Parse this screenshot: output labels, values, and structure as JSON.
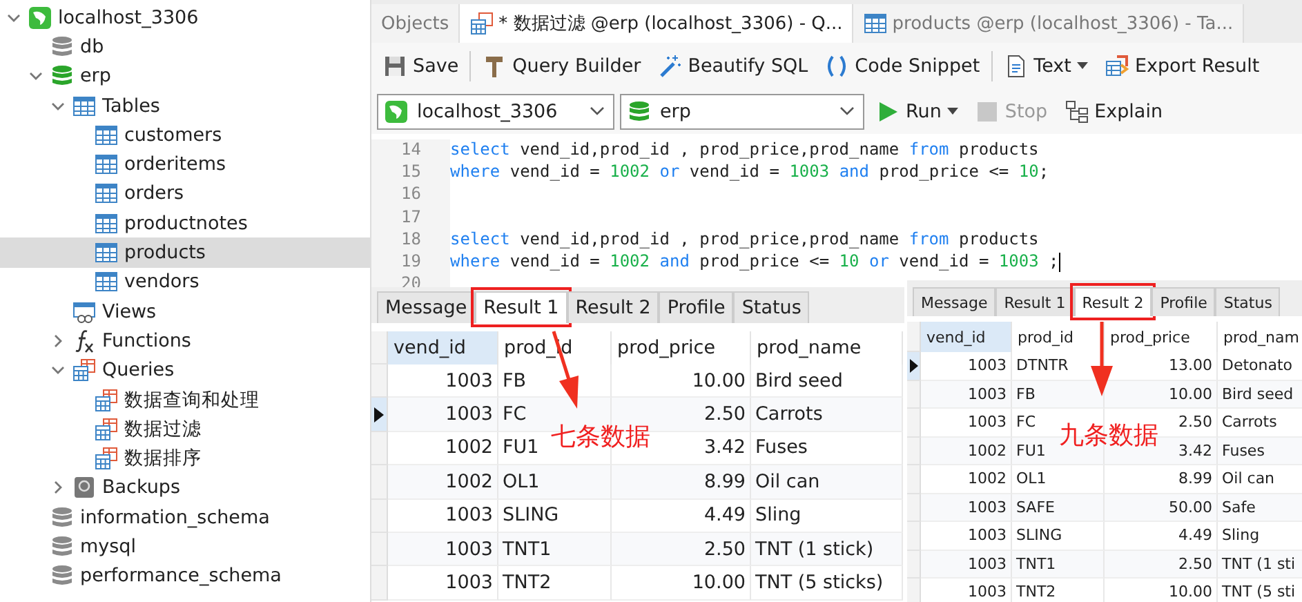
{
  "sidebar": {
    "items": [
      {
        "label": "localhost_3306",
        "kind": "connection",
        "expanded": true,
        "selected": false,
        "children": [
          {
            "label": "db",
            "kind": "database",
            "selected": false
          },
          {
            "label": "erp",
            "kind": "database-open",
            "expanded": true,
            "selected": false,
            "children": [
              {
                "label": "Tables",
                "kind": "tables",
                "expanded": true,
                "selected": false,
                "children": [
                  {
                    "label": "customers",
                    "kind": "table",
                    "selected": false
                  },
                  {
                    "label": "orderitems",
                    "kind": "table",
                    "selected": false
                  },
                  {
                    "label": "orders",
                    "kind": "table",
                    "selected": false
                  },
                  {
                    "label": "productnotes",
                    "kind": "table",
                    "selected": false
                  },
                  {
                    "label": "products",
                    "kind": "table",
                    "selected": true
                  },
                  {
                    "label": "vendors",
                    "kind": "table",
                    "selected": false
                  }
                ]
              },
              {
                "label": "Views",
                "kind": "views",
                "selected": false
              },
              {
                "label": "Functions",
                "kind": "functions",
                "expanded": false,
                "selected": false
              },
              {
                "label": "Queries",
                "kind": "queries",
                "expanded": true,
                "selected": false,
                "children": [
                  {
                    "label": "数据查询和处理",
                    "kind": "query",
                    "selected": false
                  },
                  {
                    "label": "数据过滤",
                    "kind": "query",
                    "selected": false
                  },
                  {
                    "label": "数据排序",
                    "kind": "query",
                    "selected": false
                  }
                ]
              },
              {
                "label": "Backups",
                "kind": "backups",
                "expanded": false,
                "selected": false
              }
            ]
          },
          {
            "label": "information_schema",
            "kind": "database",
            "selected": false
          },
          {
            "label": "mysql",
            "kind": "database",
            "selected": false
          },
          {
            "label": "performance_schema",
            "kind": "database",
            "selected": false
          }
        ]
      }
    ]
  },
  "tabs": [
    {
      "label": "Objects",
      "kind": "plain",
      "selected": false
    },
    {
      "label": "* 数据过滤 @erp (localhost_3306) - Q...",
      "kind": "query",
      "selected": true
    },
    {
      "label": "products @erp (localhost_3306) - Ta...",
      "kind": "table",
      "selected": false
    }
  ],
  "toolbar": [
    {
      "label": "Save",
      "kind": "save"
    },
    {
      "label": "Query Builder",
      "kind": "builder"
    },
    {
      "label": "Beautify SQL",
      "kind": "beautify"
    },
    {
      "label": "Code Snippet",
      "kind": "snippet"
    },
    {
      "label": "Text",
      "kind": "text"
    },
    {
      "label": "Export Result",
      "kind": "export"
    }
  ],
  "selectors": {
    "connection": "localhost_3306",
    "database": "erp"
  },
  "actions": [
    {
      "label": "Run",
      "kind": "run",
      "disabled": false
    },
    {
      "label": "Stop",
      "kind": "stop",
      "disabled": true
    },
    {
      "label": "Explain",
      "kind": "explain",
      "disabled": false
    }
  ],
  "editor": {
    "lines": [
      {
        "number": "14",
        "tokens": [
          {
            "text": "select",
            "kind": "keyword"
          },
          {
            "text": " vend_id,prod_id , prod_price,prod_name ",
            "kind": "plain"
          },
          {
            "text": "from",
            "kind": "keyword"
          },
          {
            "text": " products",
            "kind": "plain"
          }
        ]
      },
      {
        "number": "15",
        "tokens": [
          {
            "text": "where",
            "kind": "keyword"
          },
          {
            "text": " vend_id = ",
            "kind": "plain"
          },
          {
            "text": "1002",
            "kind": "number"
          },
          {
            "text": " or",
            "kind": "keyword"
          },
          {
            "text": " vend_id = ",
            "kind": "plain"
          },
          {
            "text": "1003",
            "kind": "number"
          },
          {
            "text": " and",
            "kind": "keyword"
          },
          {
            "text": " prod_price <= ",
            "kind": "plain"
          },
          {
            "text": "10",
            "kind": "number"
          },
          {
            "text": ";",
            "kind": "plain"
          }
        ]
      },
      {
        "number": "16"
      },
      {
        "number": "17"
      },
      {
        "number": "18",
        "tokens": [
          {
            "text": "select",
            "kind": "keyword"
          },
          {
            "text": " vend_id,prod_id , prod_price,prod_name ",
            "kind": "plain"
          },
          {
            "text": "from",
            "kind": "keyword"
          },
          {
            "text": " products",
            "kind": "plain"
          }
        ]
      },
      {
        "number": "19",
        "tokens": [
          {
            "text": "where",
            "kind": "keyword"
          },
          {
            "text": " vend_id = ",
            "kind": "plain"
          },
          {
            "text": "1002",
            "kind": "number"
          },
          {
            "text": " and",
            "kind": "keyword"
          },
          {
            "text": " prod_price <= ",
            "kind": "plain"
          },
          {
            "text": "10",
            "kind": "number"
          },
          {
            "text": " or",
            "kind": "keyword"
          },
          {
            "text": " vend_id = ",
            "kind": "plain"
          },
          {
            "text": "1003",
            "kind": "number"
          },
          {
            "text": " ;",
            "kind": "plain"
          }
        ]
      },
      {
        "number": "20"
      }
    ]
  },
  "results": [
    {
      "tabs": [
        {
          "label": "Message",
          "selected": false
        },
        {
          "label": "Result 1",
          "selected": true
        },
        {
          "label": "Result 2",
          "selected": false
        },
        {
          "label": "Profile",
          "selected": false
        },
        {
          "label": "Status",
          "selected": false
        }
      ],
      "columns": [
        {
          "label": "vend_id",
          "kind": "number"
        },
        {
          "label": "prod_id",
          "kind": "text"
        },
        {
          "label": "prod_price",
          "kind": "number"
        },
        {
          "label": "prod_name",
          "kind": "text"
        }
      ],
      "rows": [
        {
          "cells": [
            "1003",
            "FB",
            "10.00",
            "Bird seed"
          ],
          "selected": false
        },
        {
          "cells": [
            "1003",
            "FC",
            "2.50",
            "Carrots"
          ],
          "selected": true
        },
        {
          "cells": [
            "1002",
            "FU1",
            "3.42",
            "Fuses"
          ],
          "selected": false
        },
        {
          "cells": [
            "1002",
            "OL1",
            "8.99",
            "Oil can"
          ],
          "selected": false
        },
        {
          "cells": [
            "1003",
            "SLING",
            "4.49",
            "Sling"
          ],
          "selected": false
        },
        {
          "cells": [
            "1003",
            "TNT1",
            "2.50",
            "TNT (1 stick)"
          ],
          "selected": false
        },
        {
          "cells": [
            "1003",
            "TNT2",
            "10.00",
            "TNT (5 sticks)"
          ],
          "selected": false
        }
      ],
      "annotation": "七条数据"
    },
    {
      "tabs": [
        {
          "label": "Message",
          "selected": false
        },
        {
          "label": "Result 1",
          "selected": false
        },
        {
          "label": "Result 2",
          "selected": true
        },
        {
          "label": "Profile",
          "selected": false
        },
        {
          "label": "Status",
          "selected": false
        }
      ],
      "columns": [
        {
          "label": "vend_id",
          "kind": "number"
        },
        {
          "label": "prod_id",
          "kind": "text"
        },
        {
          "label": "prod_price",
          "kind": "number"
        },
        {
          "label": "prod_nam",
          "kind": "text"
        }
      ],
      "rows": [
        {
          "cells": [
            "1003",
            "DTNTR",
            "13.00",
            "Detonato"
          ],
          "selected": true
        },
        {
          "cells": [
            "1003",
            "FB",
            "10.00",
            "Bird seed"
          ],
          "selected": false
        },
        {
          "cells": [
            "1003",
            "FC",
            "2.50",
            "Carrots"
          ],
          "selected": false
        },
        {
          "cells": [
            "1002",
            "FU1",
            "3.42",
            "Fuses"
          ],
          "selected": false
        },
        {
          "cells": [
            "1002",
            "OL1",
            "8.99",
            "Oil can"
          ],
          "selected": false
        },
        {
          "cells": [
            "1003",
            "SAFE",
            "50.00",
            "Safe"
          ],
          "selected": false
        },
        {
          "cells": [
            "1003",
            "SLING",
            "4.49",
            "Sling"
          ],
          "selected": false
        },
        {
          "cells": [
            "1003",
            "TNT1",
            "2.50",
            "TNT (1 sti"
          ],
          "selected": false
        },
        {
          "cells": [
            "1003",
            "TNT2",
            "10.00",
            "TNT (5 sti"
          ],
          "selected": false
        }
      ],
      "annotation": "九条数据"
    }
  ]
}
